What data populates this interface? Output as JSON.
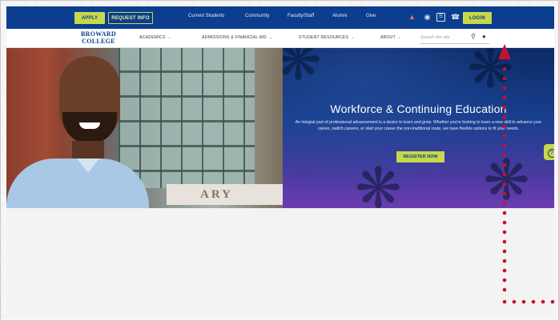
{
  "utility": {
    "apply": "APPLY",
    "request_info": "REQUEST INFO",
    "links": [
      "Current Students",
      "Community",
      "Faculty/Staff",
      "Alumni",
      "Give"
    ],
    "login": "LOGIN",
    "icons": [
      "bell-icon",
      "location-pin-icon",
      "id-card-icon",
      "phone-icon"
    ]
  },
  "nav": {
    "logo_line1": "BROWARD",
    "logo_line2": "COLLEGE",
    "items": [
      "ACADEMICS",
      "ADMISSIONS & FINANCIAL AID",
      "STUDENT RESOURCES",
      "ABOUT"
    ],
    "search_placeholder": "Search the site"
  },
  "hero": {
    "sign_text": "ARY",
    "title": "Workforce & Continuing Education",
    "description": "An integral part of professional advancement is a desire to learn and grow. Whether you're looking to learn a new skill to advance your career, switch careers, or start your career the non-traditional route, we have flexible options to fit your needs.",
    "cta": "REGISTER NOW",
    "help": "?"
  },
  "colors": {
    "brand_blue": "#0b3e8f",
    "accent_lime": "#c8d84a",
    "arrow_red": "#c4122f"
  }
}
